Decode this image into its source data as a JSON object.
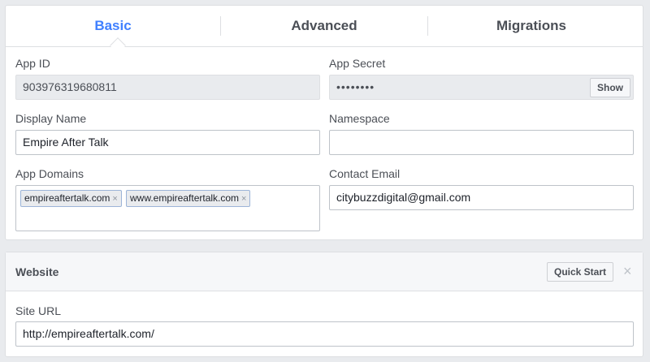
{
  "tabs": [
    {
      "label": "Basic",
      "active": true
    },
    {
      "label": "Advanced",
      "active": false
    },
    {
      "label": "Migrations",
      "active": false
    }
  ],
  "basic": {
    "app_id": {
      "label": "App ID",
      "value": "903976319680811"
    },
    "app_secret": {
      "label": "App Secret",
      "value": "••••••••",
      "show_label": "Show"
    },
    "display_name": {
      "label": "Display Name",
      "value": "Empire After Talk"
    },
    "namespace": {
      "label": "Namespace",
      "value": ""
    },
    "app_domains": {
      "label": "App Domains",
      "tags": [
        "empireaftertalk.com",
        "www.empireaftertalk.com"
      ]
    },
    "contact_email": {
      "label": "Contact Email",
      "value": "citybuzzdigital@gmail.com"
    }
  },
  "website": {
    "title": "Website",
    "quick_start_label": "Quick Start",
    "close_glyph": "×",
    "site_url": {
      "label": "Site URL",
      "value": "http://empireaftertalk.com/"
    }
  },
  "icons": {
    "tag_remove": "×"
  },
  "colors": {
    "active_tab": "#4080ff",
    "page_bg": "#e9ebee"
  }
}
